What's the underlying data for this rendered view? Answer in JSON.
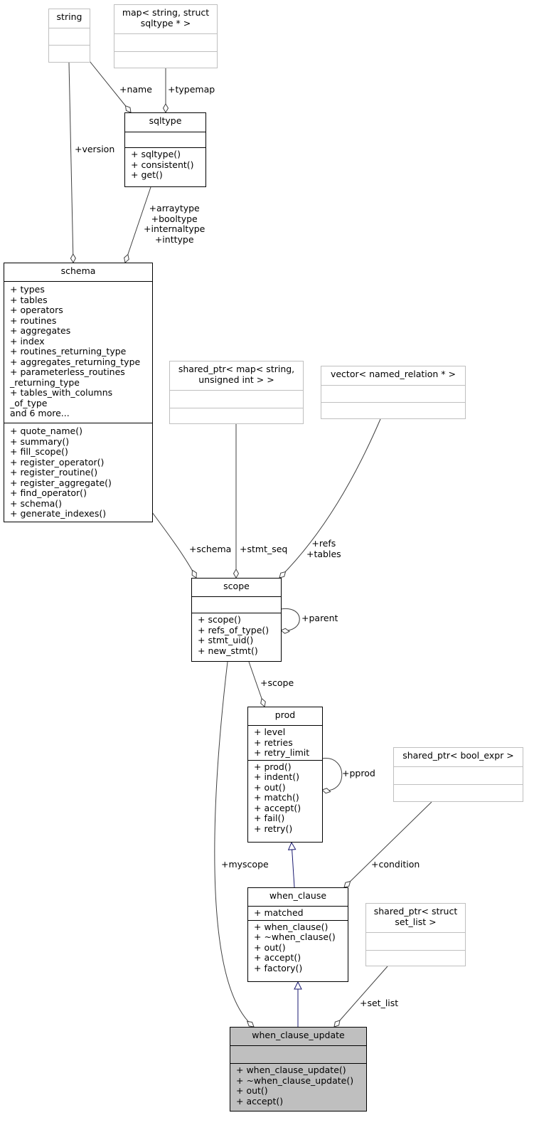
{
  "nodes": {
    "string": {
      "title": [
        "string"
      ],
      "attributes": [],
      "methods": []
    },
    "map_sqltype": {
      "title": [
        "map< string, struct",
        "sqltype * >"
      ],
      "attributes": [],
      "methods": []
    },
    "sqltype": {
      "title": [
        "sqltype"
      ],
      "attributes": [],
      "methods": [
        "+ sqltype()",
        "+ consistent()",
        "+ get()"
      ]
    },
    "schema": {
      "title": [
        "schema"
      ],
      "attributes": [
        "+ types",
        "+ tables",
        "+ operators",
        "+ routines",
        "+ aggregates",
        "+ index",
        "+ routines_returning_type",
        "+ aggregates_returning_type",
        "+ parameterless_routines",
        "_returning_type",
        "+ tables_with_columns",
        "_of_type",
        "and 6 more..."
      ],
      "methods": [
        "+ quote_name()",
        "+ summary()",
        "+ fill_scope()",
        "+ register_operator()",
        "+ register_routine()",
        "+ register_aggregate()",
        "+ find_operator()",
        "+ schema()",
        "+ generate_indexes()"
      ]
    },
    "shared_ptr_map": {
      "title": [
        "shared_ptr< map< string,",
        "unsigned int > >"
      ],
      "attributes": [],
      "methods": []
    },
    "vector_named_relation": {
      "title": [
        "vector< named_relation * >"
      ],
      "attributes": [],
      "methods": []
    },
    "scope": {
      "title": [
        "scope"
      ],
      "attributes": [],
      "methods": [
        "+ scope()",
        "+ refs_of_type()",
        "+ stmt_uid()",
        "+ new_stmt()"
      ]
    },
    "prod": {
      "title": [
        "prod"
      ],
      "attributes": [
        "+ level",
        "+ retries",
        "+ retry_limit"
      ],
      "methods": [
        "+ prod()",
        "+ indent()",
        "+ out()",
        "+ match()",
        "+ accept()",
        "+ fail()",
        "+ retry()"
      ]
    },
    "shared_ptr_bool_expr": {
      "title": [
        "shared_ptr< bool_expr >"
      ],
      "attributes": [],
      "methods": []
    },
    "when_clause": {
      "title": [
        "when_clause"
      ],
      "attributes": [
        "+ matched"
      ],
      "methods": [
        "+ when_clause()",
        "+ ~when_clause()",
        "+ out()",
        "+ accept()",
        "+ factory()"
      ]
    },
    "shared_ptr_set_list": {
      "title": [
        "shared_ptr< struct",
        "set_list >"
      ],
      "attributes": [],
      "methods": []
    },
    "when_clause_update": {
      "title": [
        "when_clause_update"
      ],
      "attributes": [],
      "methods": [
        "+ when_clause_update()",
        "+ ~when_clause_update()",
        "+ out()",
        "+ accept()"
      ]
    }
  },
  "edge_labels": {
    "name": "+name",
    "typemap": "+typemap",
    "version": "+version",
    "sqltype_roles": [
      "+arraytype",
      "+booltype",
      "+internaltype",
      "+inttype"
    ],
    "schema": "+schema",
    "stmt_seq": "+stmt_seq",
    "refs_tables": [
      "+refs",
      "+tables"
    ],
    "parent": "+parent",
    "scope": "+scope",
    "pprod": "+pprod",
    "myscope": "+myscope",
    "condition": "+condition",
    "set_list": "+set_list"
  },
  "colors": {
    "focus_fill": "#bfbfbf",
    "grey_border": "#bfbfbf",
    "inherit_edge": "#191970",
    "assoc_edge": "#404040"
  }
}
